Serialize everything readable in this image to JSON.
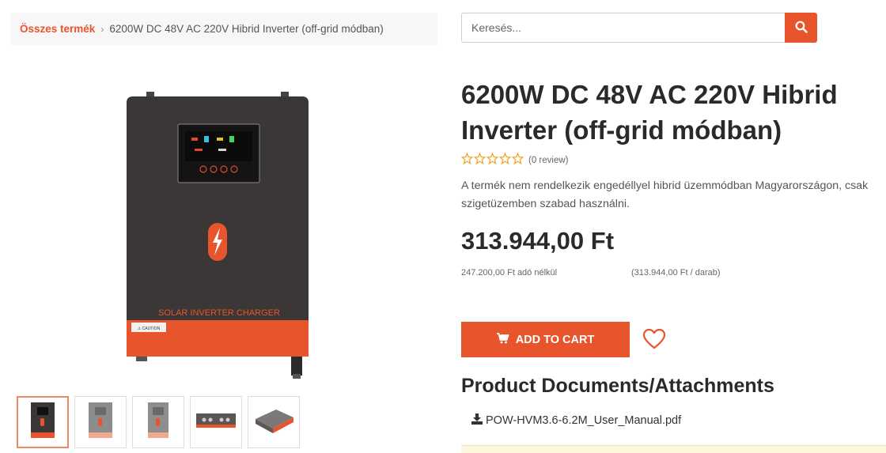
{
  "breadcrumb": {
    "link_label": "Összes termék",
    "separator": "›",
    "current_label": "6200W DC 48V AC 220V Hibrid Inverter (off-grid módban)"
  },
  "search": {
    "placeholder": "Keresés...",
    "icon": "search-icon"
  },
  "gallery": {
    "main_image_label": "SOLAR INVERTER CHARGER",
    "thumbnails": [
      {
        "icon": "inverter-front-thumbnail",
        "active": true
      },
      {
        "icon": "inverter-faded-thumbnail",
        "active": false
      },
      {
        "icon": "inverter-side-thumbnail",
        "active": false
      },
      {
        "icon": "inverter-bottom-thumbnail",
        "active": false
      },
      {
        "icon": "inverter-angled-thumbnail",
        "active": false
      }
    ]
  },
  "product": {
    "title": "6200W DC 48V AC 220V Hibrid Inverter (off-grid módban)",
    "rating_stars": 0,
    "review_count": "(0 review)",
    "notice": "A termék nem rendelkezik engedéllyel hibrid üzemmódban Magyarországon, csak szigetüzemben szabad használni.",
    "price": "313.944,00 Ft",
    "net_price": "247.200,00 Ft adó nélkül",
    "unit_price": "(313.944,00 Ft / darab)",
    "add_to_cart_label": "ADD TO CART"
  },
  "documents": {
    "heading": "Product Documents/Attachments",
    "files": [
      {
        "name": "POW-HVM3.6-6.2M_User_Manual.pdf",
        "icon": "download-icon"
      }
    ]
  },
  "colors": {
    "accent": "#e8552d",
    "star": "#f0a526",
    "body_dark": "#3a3736"
  }
}
